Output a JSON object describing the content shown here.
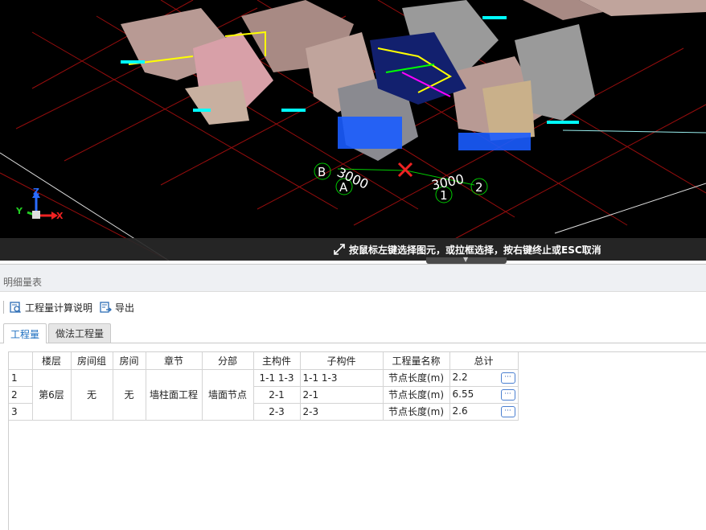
{
  "viewport": {
    "hint": "按鼠标左键选择图元，或拉框选择，按右键终止或ESC取消",
    "axis": {
      "x": "X",
      "y": "Y",
      "z": "Z"
    },
    "grid_labels": {
      "b": "B",
      "a": "A",
      "one": "1",
      "two": "2"
    },
    "dims": {
      "left": "3000",
      "right": "3000"
    }
  },
  "panel": {
    "title": "明细量表",
    "toolbar": {
      "calc_note": "工程量计算说明",
      "export": "导出"
    },
    "tabs": [
      "工程量",
      "做法工程量"
    ],
    "table": {
      "headers": [
        "",
        "楼层",
        "房间组",
        "房间",
        "章节",
        "分部",
        "主构件",
        "子构件",
        "工程量名称",
        "总计"
      ],
      "merged": {
        "floor": "第6层",
        "room_group": "无",
        "room": "无",
        "chapter": "墙柱面工程",
        "division": "墙面节点"
      },
      "rows": [
        {
          "no": "1",
          "main": "1-1 1-3",
          "sub": "1-1 1-3",
          "qty_name": "节点长度(m)",
          "total": "2.2"
        },
        {
          "no": "2",
          "main": "2-1",
          "sub": "2-1",
          "qty_name": "节点长度(m)",
          "total": "6.55"
        },
        {
          "no": "3",
          "main": "2-3",
          "sub": "2-3",
          "qty_name": "节点长度(m)",
          "total": "2.6"
        }
      ],
      "more_label": "···"
    }
  },
  "colors": {
    "accent": "#1d6fc0",
    "viewport_bg": "#000000",
    "cad_red": "#d01010",
    "wall": "#c8a8a0"
  }
}
